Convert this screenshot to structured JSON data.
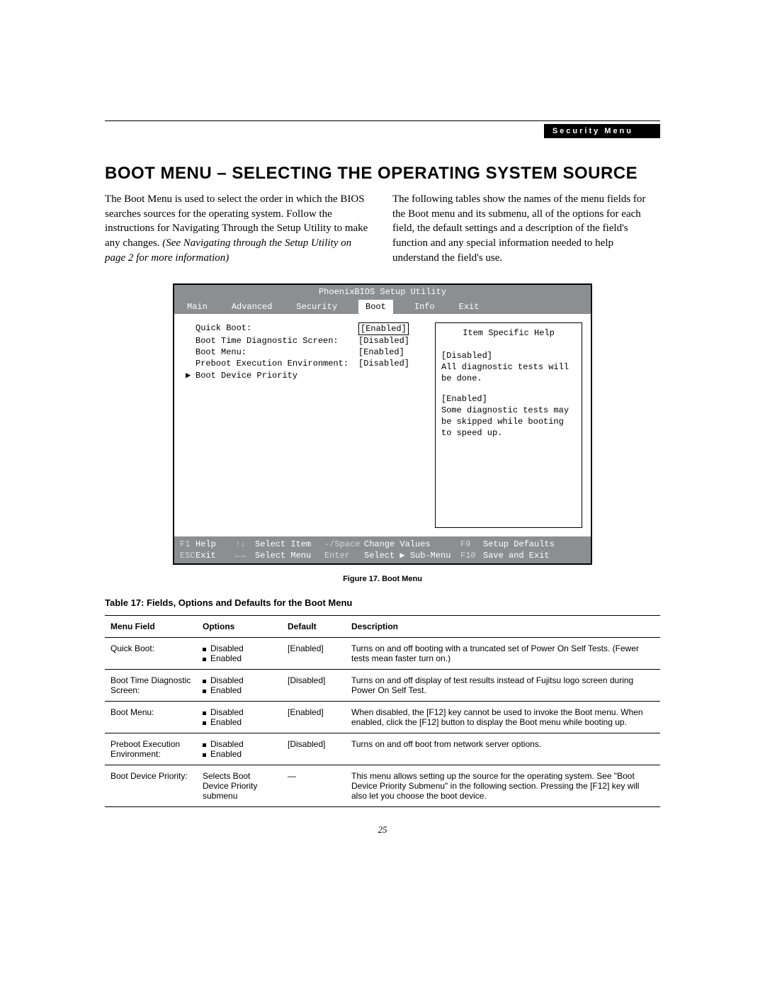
{
  "header": {
    "tab": "Security Menu"
  },
  "section_title": "BOOT MENU – SELECTING THE OPERATING SYSTEM SOURCE",
  "intro": {
    "left": "The Boot Menu is used to select the order in which the BIOS searches sources for the operating system. Follow the instructions for Navigating Through the Setup Utility to make any changes. ",
    "left_ital": "(See Navigating through the Setup Utility on page 2 for more information)",
    "right": "The following tables show the names of the menu fields for the Boot menu and its submenu, all of the options for each field, the default settings and a description of the field's function and any special information needed to help understand the field's use."
  },
  "bios": {
    "title": "PhoenixBIOS Setup Utility",
    "tabs": {
      "t0": "Main",
      "t1": "Advanced",
      "t2": "Security",
      "t3": "Boot",
      "t4": "Info",
      "t5": "Exit"
    },
    "items": {
      "r0l": "Quick Boot:",
      "r0v": "[Enabled]",
      "r1l": "Boot Time Diagnostic Screen:",
      "r1v": "[Disabled]",
      "r2l": "Boot Menu:",
      "r2v": "[Enabled]",
      "r3l": "Preboot Execution Environment:",
      "r3v": "[Disabled]",
      "r4l": "Boot Device Priority"
    },
    "help": {
      "head": "Item Specific Help",
      "p1": "[Disabled]",
      "p2": "All diagnostic tests will be done.",
      "p3": "[Enabled]",
      "p4": "Some diagnostic tests may be skipped while booting to speed up."
    },
    "foot": {
      "a0": "F1",
      "a1": "Help",
      "a2": "↑↓",
      "a3": "Select Item",
      "a4": "-/Space",
      "a5": "Change Values",
      "a6": "F9",
      "a7": "Setup Defaults",
      "b0": "ESC",
      "b1": "Exit",
      "b2": "←→",
      "b3": "Select Menu",
      "b4": "Enter",
      "b5": "Select ▶ Sub-Menu",
      "b6": "F10",
      "b7": "Save and Exit"
    }
  },
  "figure_caption": "Figure 17.  Boot Menu",
  "table_title": "Table 17: Fields, Options and Defaults for the Boot Menu",
  "table": {
    "h0": "Menu Field",
    "h1": "Options",
    "h2": "Default",
    "h3": "Description",
    "r0": {
      "f": "Quick Boot:",
      "o0": "Disabled",
      "o1": "Enabled",
      "d": "[Enabled]",
      "desc": "Turns on and off booting with a truncated set of Power On Self Tests. (Fewer tests mean faster turn on.)"
    },
    "r1": {
      "f": "Boot Time Diagnostic Screen:",
      "o0": "Disabled",
      "o1": "Enabled",
      "d": "[Disabled]",
      "desc": "Turns on and off display of test results instead of Fujitsu logo screen during Power On Self Test."
    },
    "r2": {
      "f": "Boot Menu:",
      "o0": "Disabled",
      "o1": "Enabled",
      "d": "[Enabled]",
      "desc": "When disabled, the [F12] key cannot be used to invoke the Boot menu. When enabled, click the [F12] button to display the Boot menu while booting up."
    },
    "r3": {
      "f": "Preboot Execution Environment:",
      "o0": "Disabled",
      "o1": "Enabled",
      "d": "[Disabled]",
      "desc": "Turns on and off boot from network server options."
    },
    "r4": {
      "f": "Boot Device Priority:",
      "osingle": "Selects Boot Device Priority submenu",
      "d": "—",
      "desc": "This menu allows setting up the source for the operating system. See \"Boot Device Priority Submenu\" in the following section. Pressing the [F12] key will also let you choose the boot device."
    }
  },
  "page_num": "25"
}
